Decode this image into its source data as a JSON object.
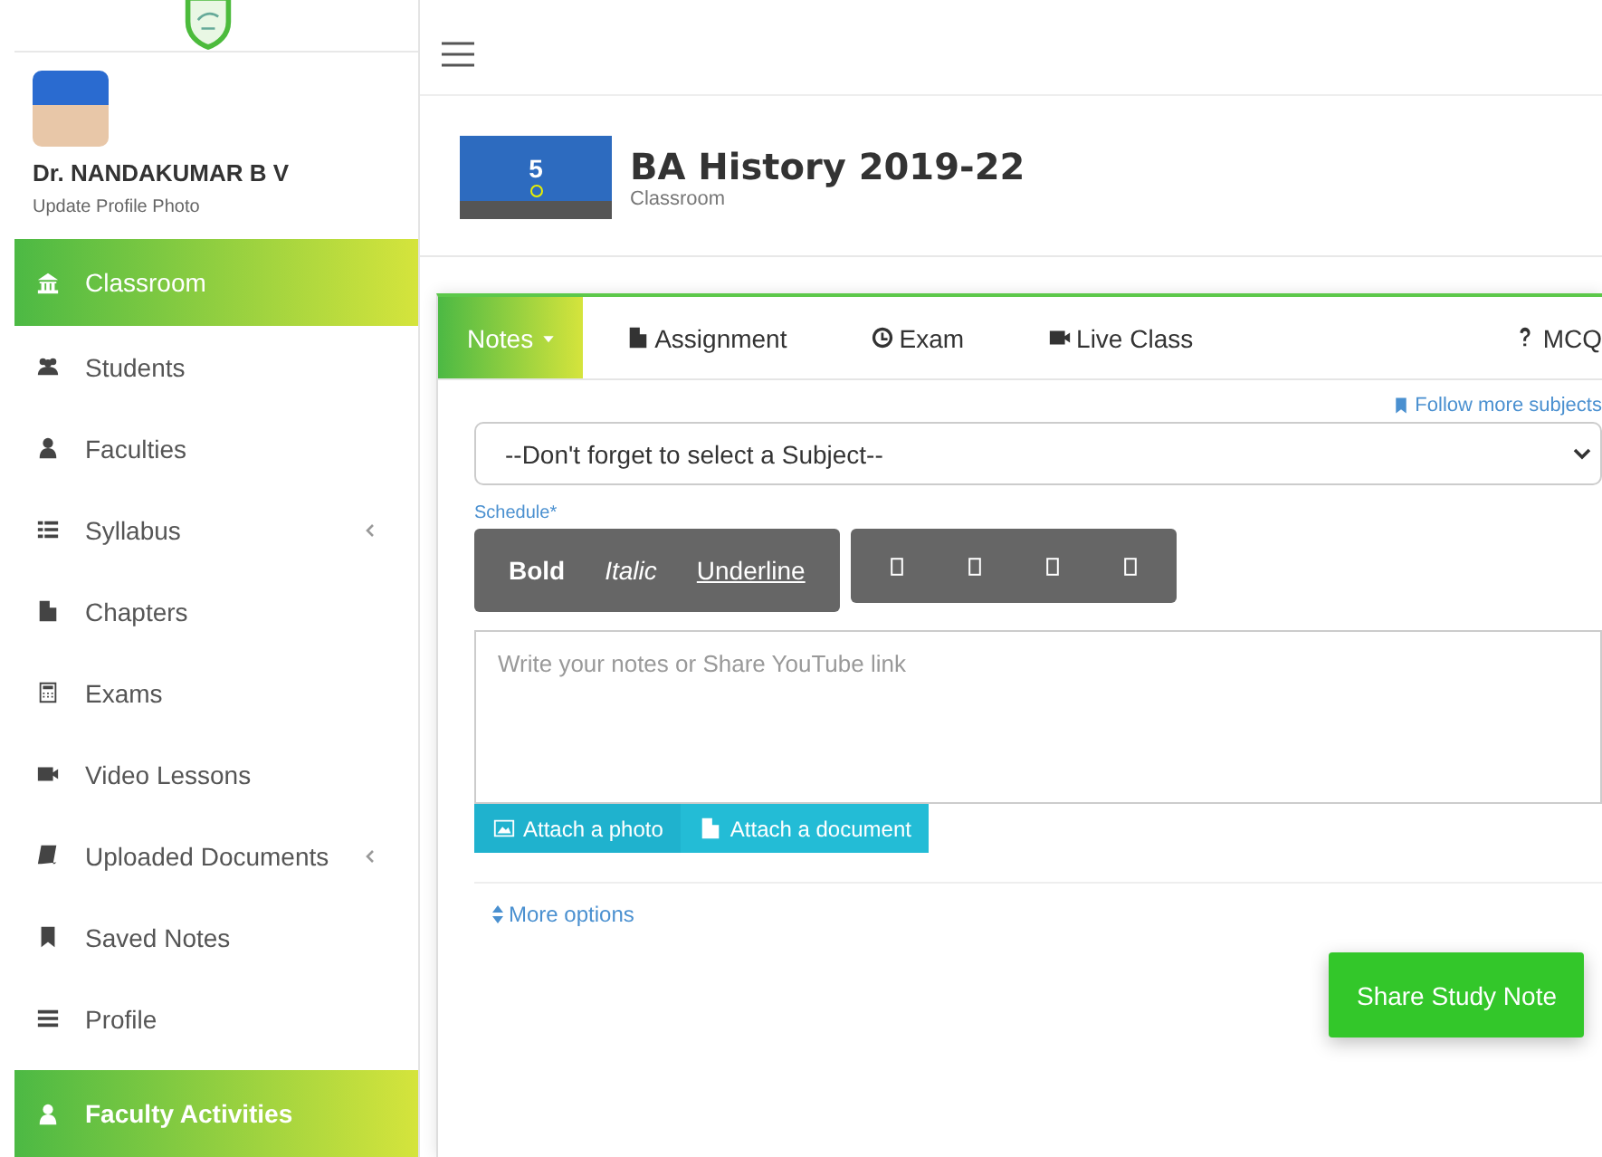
{
  "user": {
    "name": "Dr. NANDAKUMAR B V",
    "link": "Update Profile Photo"
  },
  "sidebar": {
    "items": [
      {
        "label": "Classroom",
        "selected": true,
        "submenu": false
      },
      {
        "label": "Students",
        "selected": false,
        "submenu": false
      },
      {
        "label": "Faculties",
        "selected": false,
        "submenu": false
      },
      {
        "label": "Syllabus",
        "selected": false,
        "submenu": true
      },
      {
        "label": "Chapters",
        "selected": false,
        "submenu": false
      },
      {
        "label": "Exams",
        "selected": false,
        "submenu": false
      },
      {
        "label": "Video Lessons",
        "selected": false,
        "submenu": false
      },
      {
        "label": "Uploaded Documents",
        "selected": false,
        "submenu": true
      },
      {
        "label": "Saved Notes",
        "selected": false,
        "submenu": false
      },
      {
        "label": "Profile",
        "selected": false,
        "submenu": false
      }
    ],
    "section": {
      "label": "Faculty Activities"
    }
  },
  "header": {
    "badge": "5",
    "title": "BA History 2019-22",
    "subtitle": "Classroom"
  },
  "tabs": [
    {
      "label": "Notes",
      "selected": true
    },
    {
      "label": "Assignment",
      "selected": false
    },
    {
      "label": "Exam",
      "selected": false
    },
    {
      "label": "Live Class",
      "selected": false
    },
    {
      "label": "MCQ",
      "selected": false
    }
  ],
  "form": {
    "follow_link": "Follow more subjects",
    "subject_select": "--Don't forget to select a Subject--",
    "schedule_label": "Schedule*",
    "format_buttons": [
      {
        "label": "Bold",
        "kind": "bold"
      },
      {
        "label": "Italic",
        "kind": "italic"
      },
      {
        "label": "Underline",
        "kind": "underline"
      }
    ],
    "notes": {
      "placeholder": "Write your notes or Share YouTube link"
    },
    "attach_buttons": [
      {
        "label": "Attach a photo"
      },
      {
        "label": "Attach a document"
      }
    ],
    "more_options": "More options",
    "submit": "Share Study Note"
  }
}
